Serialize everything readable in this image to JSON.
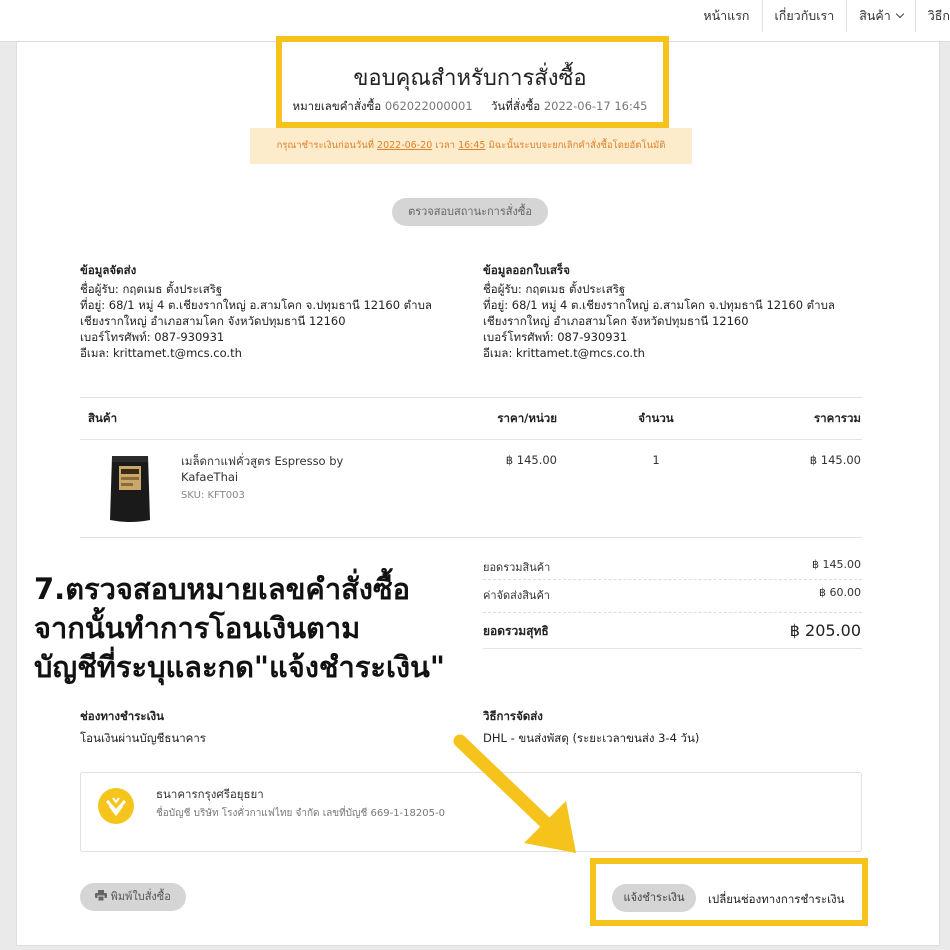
{
  "nav": {
    "items": [
      {
        "label": "หน้าแรก"
      },
      {
        "label": "เกี่ยวกับเรา"
      },
      {
        "label": "สินค้า"
      },
      {
        "label": "วิธีก"
      }
    ]
  },
  "header": {
    "title": "ขอบคุณสำหรับการสั่งซื้อ",
    "order_no_label": "หมายเลขคำสั่งซื้อ",
    "order_no": "062022000001",
    "order_date_label": "วันที่สั่งซื้อ",
    "order_date": "2022-06-17 16:45"
  },
  "notice": {
    "prefix": "กรุณาชำระเงินก่อนวันที่",
    "date": "2022-06-20",
    "time_label": "เวลา",
    "time": "16:45",
    "suffix": "มิฉะนั้นระบบจะยกเลิกคำสั่งซื้อโดยอัตโนมัติ"
  },
  "check_status_button": "ตรวจสอบสถานะการสั่งซื้อ",
  "shipping_info": {
    "heading": "ข้อมูลจัดส่ง",
    "lines": [
      "ชื่อผู้รับ: กฤตเมธ ตั้งประเสริฐ",
      "ที่อยู่: 68/1 หมู่ 4 ต.เชียงรากใหญ่ อ.สามโคก จ.ปทุมธานี 12160 ตำบล",
      "เชียงรากใหญ่ อำเภอสามโคก จังหวัดปทุมธานี 12160",
      "เบอร์โทรศัพท์: 087-930931",
      "อีเมล: krittamet.t@mcs.co.th"
    ]
  },
  "billing_info": {
    "heading": "ข้อมูลออกใบเสร็จ",
    "lines": [
      "ชื่อผู้รับ: กฤตเมธ ตั้งประเสริฐ",
      "ที่อยู่: 68/1 หมู่ 4 ต.เชียงรากใหญ่ อ.สามโคก จ.ปทุมธานี 12160 ตำบล",
      "เชียงรากใหญ่ อำเภอสามโคก จังหวัดปทุมธานี 12160",
      "เบอร์โทรศัพท์: 087-930931",
      "อีเมล: krittamet.t@mcs.co.th"
    ]
  },
  "table": {
    "headers": [
      "สินค้า",
      "ราคา/หน่วย",
      "จำนวน",
      "ราคารวม"
    ],
    "item": {
      "name_line1": "เมล็ดกาแฟคั่วสูตร Espresso by",
      "name_line2": "KafaeThai",
      "sku": "SKU: KFT003",
      "unit_price": "฿ 145.00",
      "qty": "1",
      "total": "฿ 145.00"
    }
  },
  "summary": {
    "subtotal_label": "ยอดรวมสินค้า",
    "subtotal": "฿ 145.00",
    "shipping_label": "ค่าจัดส่งสินค้า",
    "shipping": "฿ 60.00",
    "grand_label": "ยอดรวมสุทธิ",
    "grand": "฿ 205.00"
  },
  "overlay": {
    "lines": [
      "7.ตรวจสอบหมายเลขคำสั่งซื้อ",
      "จากนั้นทำการโอนเงินตาม",
      "บัญชีที่ระบุและกด\"แจ้งชำระเงิน\""
    ]
  },
  "payment": {
    "heading": "ช่องทางชำระเงิน",
    "method": "โอนเงินผ่านบัญชีธนาคาร",
    "bank_name": "ธนาคารกรุงศรีอยุธยา",
    "account": "ชื่อบัญชี บริษัท โรงคั่วกาแฟไทย จำกัด เลขที่บัญชี 669-1-18205-0",
    "bank_icon": "krungsri-logo-icon"
  },
  "delivery": {
    "heading": "วิธีการจัดส่ง",
    "method": "DHL - ขนส่งพัสดุ (ระยะเวลาขนส่ง 3-4 วัน)"
  },
  "actions": {
    "print": "พิมพ์ใบสั่งซื้อ",
    "print_icon": "printer-icon",
    "notify_payment": "แจ้งชำระเงิน",
    "change_payment": "เปลี่ยนช่องทางการชำระเงิน"
  },
  "colors": {
    "highlight": "#f6c21c",
    "notice_bg": "#fdeccb",
    "notice_text": "#e0802a",
    "arrow": "#f6c21c"
  }
}
